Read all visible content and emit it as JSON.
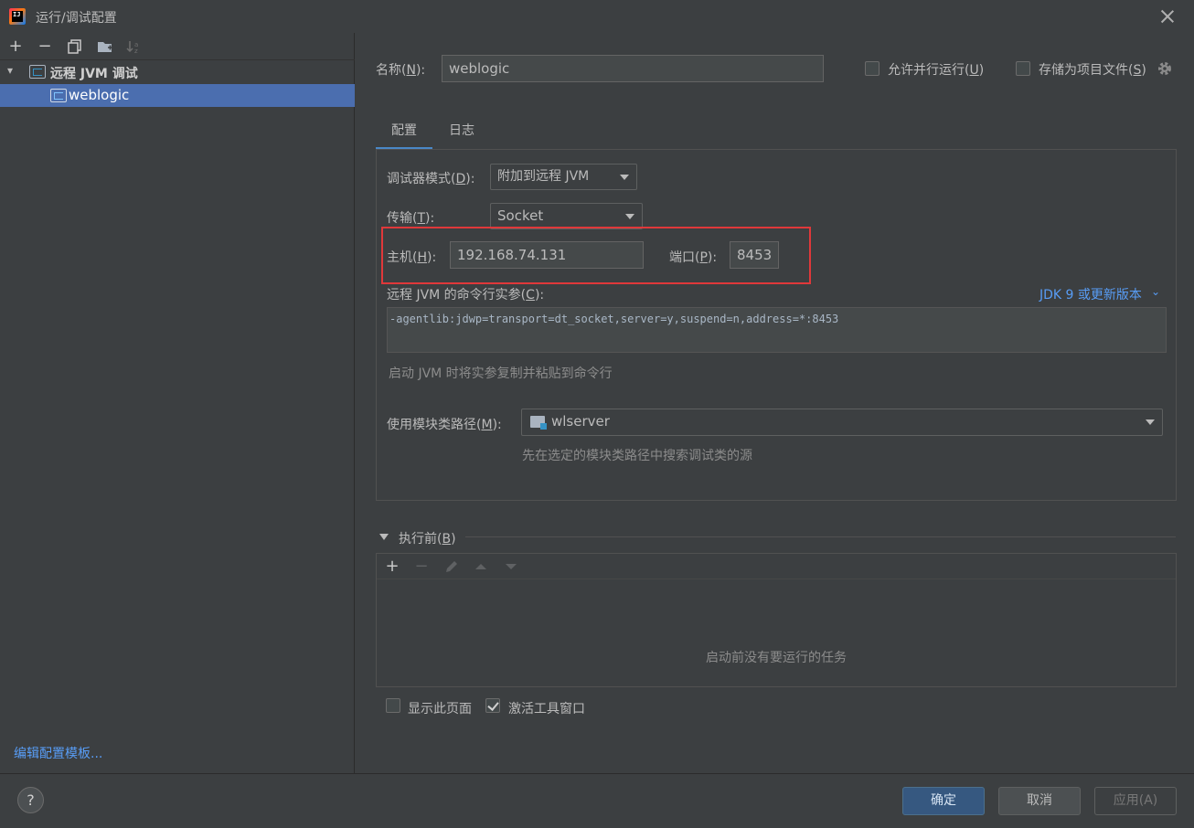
{
  "window": {
    "title": "运行/调试配置",
    "app_icon_text": "IJ"
  },
  "sidebar": {
    "toolbar": [
      "add-icon",
      "remove-icon",
      "copy-icon",
      "folder-add-icon",
      "sort-icon"
    ],
    "tree": {
      "root_label": "远程 JVM 调试",
      "child_label": "weblogic"
    },
    "edit_templates": "编辑配置模板..."
  },
  "header": {
    "name_label": "名称(",
    "name_mnemonic": "N",
    "name_value": "weblogic",
    "allow_parallel_label": "允许并行运行(",
    "allow_parallel_mnemonic": "U",
    "allow_parallel_checked": false,
    "store_project_label": "存储为项目文件(",
    "store_project_mnemonic": "S",
    "store_project_checked": false
  },
  "tabs": [
    {
      "label": "配置",
      "active": true
    },
    {
      "label": "日志",
      "active": false
    }
  ],
  "config": {
    "debugger_mode_label": "调试器模式(",
    "debugger_mode_mnemonic": "D",
    "debugger_mode_value": "附加到远程 JVM",
    "transport_label": "传输(",
    "transport_mnemonic": "T",
    "transport_value": "Socket",
    "host_label": "主机(",
    "host_mnemonic": "H",
    "host_value": "192.168.74.131",
    "port_label": "端口(",
    "port_mnemonic": "P",
    "port_value": "8453",
    "cmd_label": "远程 JVM 的命令行实参(",
    "cmd_mnemonic": "C",
    "jdk_link": "JDK 9 或更新版本",
    "cmd_value": "-agentlib:jdwp=transport=dt_socket,server=y,suspend=n,address=*:8453",
    "cmd_hint": "启动 JVM 时将实参复制并粘贴到命令行",
    "module_label": "使用模块类路径(",
    "module_mnemonic": "M",
    "module_value": "wlserver",
    "module_hint": "先在选定的模块类路径中搜索调试类的源"
  },
  "before_launch": {
    "title": "执行前(",
    "mnemonic": "B",
    "toolbar": [
      "add-icon",
      "remove-icon",
      "edit-icon",
      "move-up-icon",
      "move-down-icon"
    ],
    "empty_text": "启动前没有要运行的任务"
  },
  "options": {
    "show_page_label": "显示此页面",
    "show_page_checked": false,
    "activate_tool_label": "激活工具窗口",
    "activate_tool_checked": true
  },
  "buttons": {
    "help": "?",
    "ok": "确定",
    "cancel": "取消",
    "apply": "应用(A)"
  },
  "colors": {
    "accent": "#4a88c7",
    "selection": "#4b6eaf",
    "link": "#589df6",
    "highlight_box": "#e0383a",
    "ok_button": "#365880"
  }
}
